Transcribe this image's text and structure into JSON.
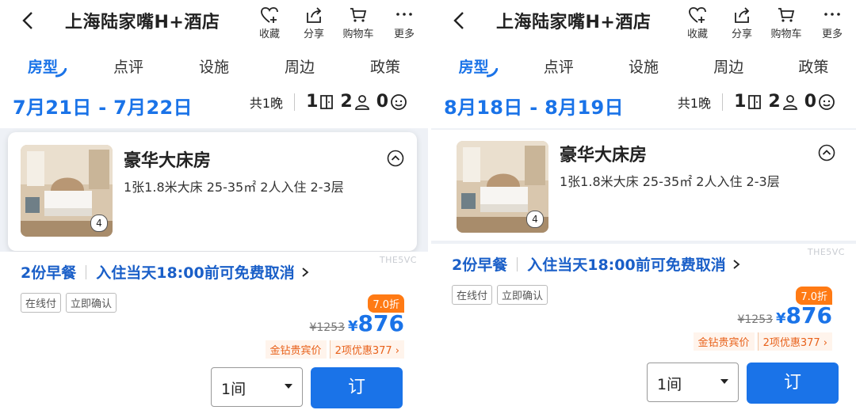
{
  "header": {
    "title": "上海陆家嘴H+酒店",
    "actions": {
      "favorite": "收藏",
      "share": "分享",
      "cart": "购物车",
      "more": "更多"
    }
  },
  "tabs": [
    "房型",
    "点评",
    "设施",
    "周边",
    "政策"
  ],
  "panels": [
    {
      "dates": "7月21日 - 7月22日",
      "nights": "共1晚",
      "rooms": "1",
      "adults": "2",
      "children": "0"
    },
    {
      "dates": "8月18日 - 8月19日",
      "nights": "共1晚",
      "rooms": "1",
      "adults": "2",
      "children": "0"
    }
  ],
  "room": {
    "name": "豪华大床房",
    "spec": "1张1.8米大床  25-35㎡  2人入住  2-3层",
    "photo_count": "4"
  },
  "rate": {
    "watermark": "THE5VC",
    "breakfast": "2份早餐",
    "cancel": "入住当天18:00前可免费取消",
    "tags": [
      "在线付",
      "立即确认"
    ],
    "discount": "7.0折",
    "original_price": "¥1253",
    "currency": "¥",
    "price": "876",
    "vip": "金钻贵宾价",
    "deals": "2项优惠377",
    "quantity": "1间",
    "book": "订"
  },
  "colors": {
    "accent": "#1a73e8",
    "promo": "#e8611a",
    "discount_bg": "#ff7a14"
  }
}
